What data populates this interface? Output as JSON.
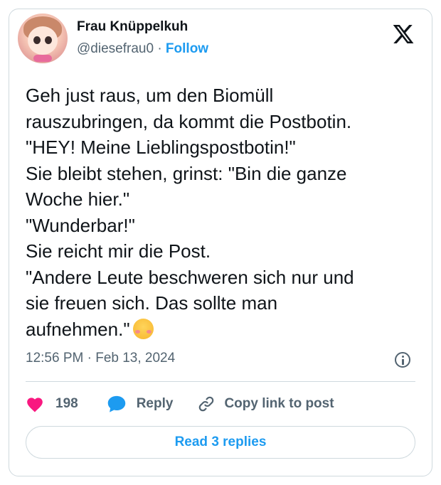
{
  "author": {
    "name": "Frau Knüppelkuh",
    "handle": "@diesefrau0",
    "separator": "·",
    "follow_label": "Follow"
  },
  "tweet": {
    "text": "Geh just raus, um den Biomüll\nrauszubringen, da kommt die Postbotin.\n\"HEY! Meine Lieblingspostbotin!\"\nSie bleibt stehen, grinst: \"Bin die ganze\nWoche hier.\"\n\"Wunderbar!\"\nSie reicht mir die Post.\n\"Andere Leute beschweren sich nur und\nsie freuen sich. Das sollte man\naufnehmen.\"",
    "emoji": "smiling-face-with-blush",
    "timestamp": "12:56 PM · Feb 13, 2024"
  },
  "actions": {
    "like_count": "198",
    "reply_label": "Reply",
    "copy_label": "Copy link to post"
  },
  "footer": {
    "read_replies_label": "Read 3 replies"
  },
  "icons": [
    "x-logo-icon",
    "info-icon",
    "heart-icon",
    "reply-bubble-icon",
    "link-icon"
  ],
  "colors": {
    "accent": "#1d9bf0",
    "heart": "#f91880",
    "secondary_text": "#536471",
    "border": "#cfd9de"
  }
}
